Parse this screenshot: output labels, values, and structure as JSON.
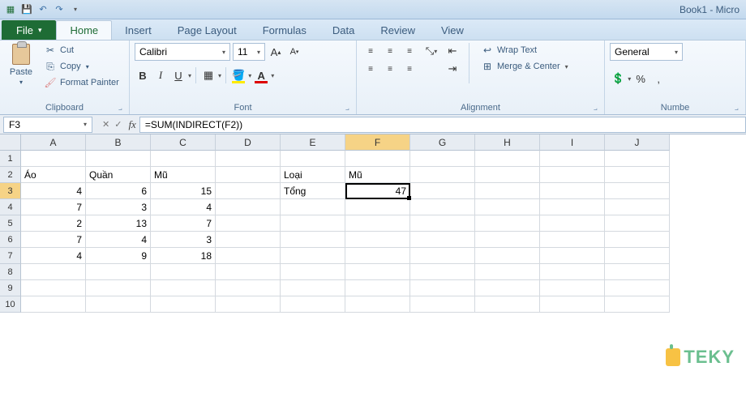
{
  "titlebar": {
    "doc_name": "Book1 - Micro"
  },
  "tabs": {
    "file": "File",
    "home": "Home",
    "insert": "Insert",
    "page_layout": "Page Layout",
    "formulas": "Formulas",
    "data": "Data",
    "review": "Review",
    "view": "View"
  },
  "ribbon": {
    "clipboard": {
      "label": "Clipboard",
      "paste": "Paste",
      "cut": "Cut",
      "copy": "Copy",
      "format_painter": "Format Painter"
    },
    "font": {
      "label": "Font",
      "name": "Calibri",
      "size": "11"
    },
    "alignment": {
      "label": "Alignment",
      "wrap": "Wrap Text",
      "merge": "Merge & Center"
    },
    "number": {
      "label": "Numbe",
      "format": "General"
    }
  },
  "namebox": "F3",
  "formula": "=SUM(INDIRECT(F2))",
  "columns": [
    "A",
    "B",
    "C",
    "D",
    "E",
    "F",
    "G",
    "H",
    "I",
    "J"
  ],
  "rows": [
    "1",
    "2",
    "3",
    "4",
    "5",
    "6",
    "7",
    "8",
    "9",
    "10"
  ],
  "selected_col": "F",
  "selected_row": "3",
  "grid": {
    "r2": {
      "A": "Áo",
      "B": "Quần",
      "C": "Mũ",
      "E": "Loại",
      "F": "Mũ"
    },
    "r3": {
      "A": "4",
      "B": "6",
      "C": "15",
      "E": "Tổng",
      "F": "47"
    },
    "r4": {
      "A": "7",
      "B": "3",
      "C": "4"
    },
    "r5": {
      "A": "2",
      "B": "13",
      "C": "7"
    },
    "r6": {
      "A": "7",
      "B": "4",
      "C": "3"
    },
    "r7": {
      "A": "4",
      "B": "9",
      "C": "18"
    }
  },
  "watermark": "TEKY"
}
